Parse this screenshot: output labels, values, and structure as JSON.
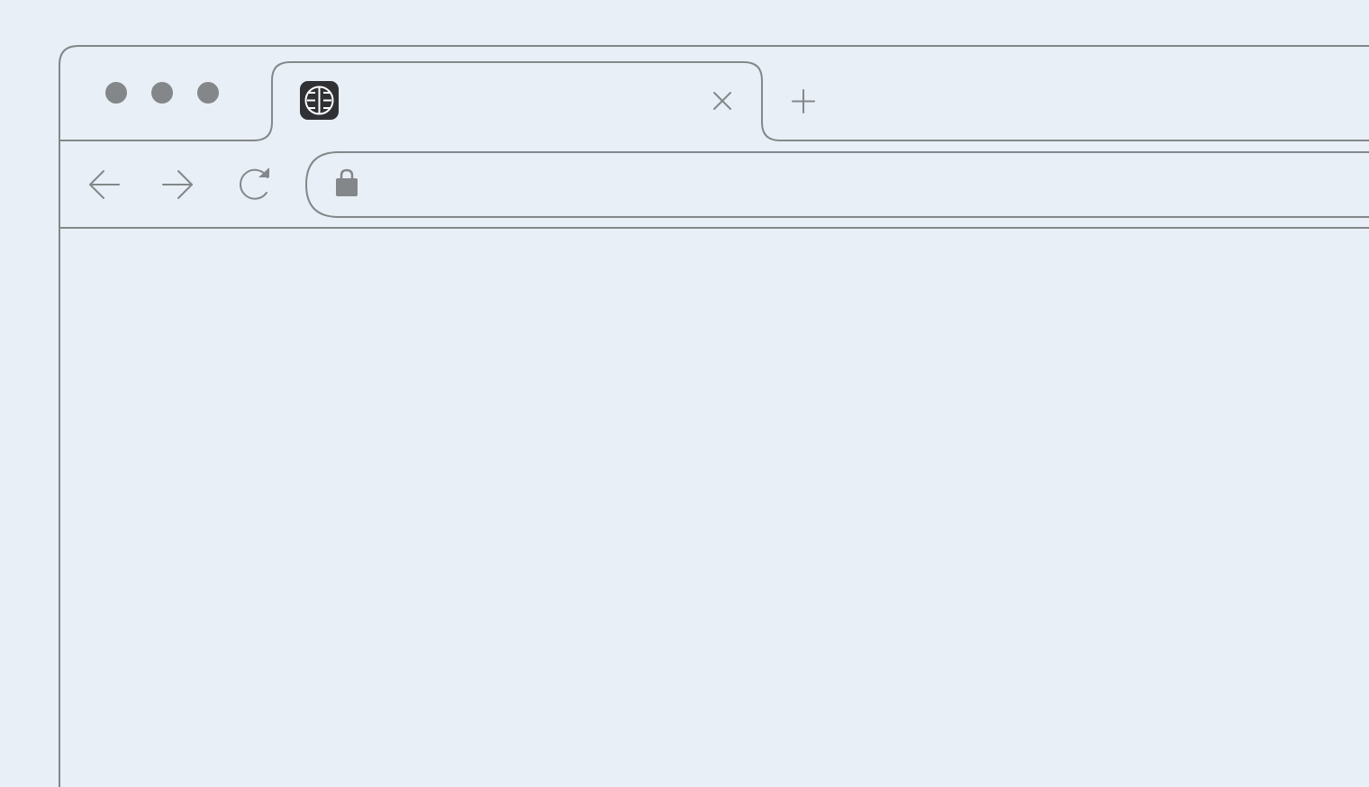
{
  "window": {
    "controls": [
      "window-dot-1",
      "window-dot-2",
      "window-dot-3"
    ]
  },
  "tab": {
    "favicon_icon": "favicon-logo-icon",
    "close_icon": "close-icon"
  },
  "new_tab": {
    "icon": "plus-icon"
  },
  "toolbar": {
    "back_icon": "arrow-left-icon",
    "forward_icon": "arrow-right-icon",
    "reload_icon": "reload-icon"
  },
  "address_bar": {
    "lock_icon": "lock-icon",
    "value": ""
  },
  "colors": {
    "background": "#e8eff6",
    "stroke": "#848789",
    "favicon_bg": "#2f3134",
    "favicon_fg": "#ffffff"
  }
}
